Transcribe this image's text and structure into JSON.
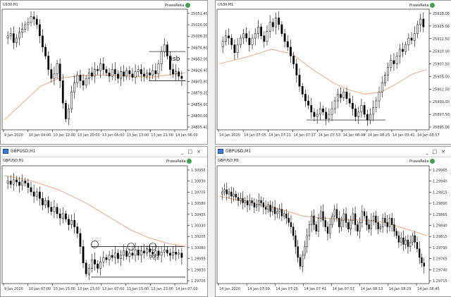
{
  "windows": [
    {
      "id": "w1",
      "symbol": "US30,H1",
      "has_titlebar": false,
      "brand": "PrawaReka",
      "y_ticks": [
        "25051.40",
        "25026.00",
        "25000.20",
        "24974.60",
        "24952.00",
        "24926.40",
        "24903.80",
        "24879.20",
        "24854.60",
        "24830.00",
        "24805.40"
      ],
      "x_ticks": [
        "9 Jan 2020",
        "10 Jan 04:00",
        "10 Jan 12:00",
        "10 Jan 20:00",
        "13 Jan 05:00",
        "13 Jan 13:00",
        "13 Jan 21:00",
        "14 Jan 06:00"
      ],
      "annotation": "isb",
      "colors": {
        "bull": "#ffffff",
        "bear": "#000000",
        "ma": "#f4a070"
      }
    },
    {
      "id": "w2",
      "symbol": "US30,M1",
      "has_titlebar": false,
      "brand": "PrawaReka",
      "y_ticks": [
        "25918.00",
        "25915.00",
        "25912.50",
        "25910.00",
        "25907.50",
        "25905.00",
        "25902.50",
        "25900.00",
        "25897.50",
        "25895.00"
      ],
      "x_ticks": [
        "14 Jan 2020",
        "14 Jan 07:05",
        "14 Jan 07:21",
        "14 Jan 07:37",
        "14 Jan 07:53",
        "14 Jan 08:09",
        "14 Jan 08:25",
        "14 Jan 09:41",
        "14 Jan 08:57"
      ],
      "annotation": "",
      "colors": {
        "bull": "#ffffff",
        "bear": "#000000",
        "ma": "#f4a070"
      }
    },
    {
      "id": "w3",
      "symbol": "GBPUSD,H1",
      "title": "GBPUSD,H1",
      "has_titlebar": true,
      "brand": "PrawaReka",
      "y_ticks": [
        "1.30955",
        "1.30830",
        "1.30705",
        "1.30580",
        "1.30455",
        "1.30330",
        "1.30205",
        "1.30080",
        "1.29955",
        "1.29830",
        "1.29705"
      ],
      "x_ticks": [
        "9 Jan 2020",
        "10 Jan 07:00",
        "10 Jan 15:00",
        "10 Jan 23:00",
        "13 Jan 07:00",
        "13 Jan 15:00",
        "13 Jan 23:00",
        "14 Jan 07:00"
      ],
      "annotation": "???",
      "colors": {
        "bull": "#ffffff",
        "bear": "#000000",
        "ma": "#f4a070"
      }
    },
    {
      "id": "w4",
      "symbol": "GBPUSD,M1",
      "title": "GBPUSD,M1",
      "has_titlebar": true,
      "brand": "PrawaReka",
      "y_ticks": [
        "1.29965",
        "1.29940",
        "1.29915",
        "1.29890",
        "1.29865",
        "1.29840",
        "1.29815",
        "1.29790",
        "1.29765",
        "1.29740",
        "1.29715"
      ],
      "x_ticks": [
        "14 Jan 2020",
        "14 Jan 07:09",
        "14 Jan 07:25",
        "14 Jan 07:41",
        "14 Jan 07:57",
        "14 Jan 08:13",
        "14 Jan 08:29",
        "14 Jan 08:45"
      ],
      "annotation": "",
      "colors": {
        "bull": "#ffffff",
        "bear": "#000000",
        "ma": "#f4a070"
      }
    }
  ],
  "window_buttons": {
    "minimize": "_",
    "maximize": "□",
    "close": "×"
  }
}
